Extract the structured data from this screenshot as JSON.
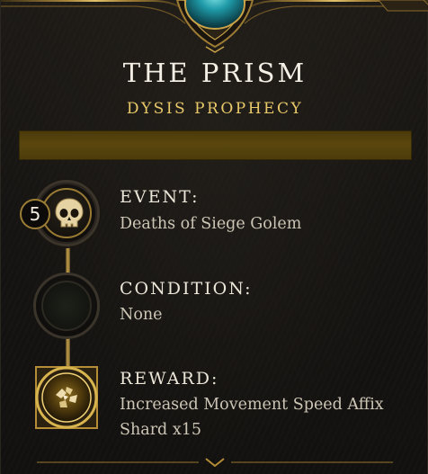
{
  "header": {
    "title": "THE PRISM",
    "subtitle": "DYSIS PROPHECY"
  },
  "progress": {
    "fraction": 0,
    "fill_color": "#5c470c",
    "track_color": "#4a3a0a"
  },
  "event": {
    "label": "EVENT:",
    "value": "Deaths of Siege Golem",
    "count_badge": "5",
    "icon": "skull-icon"
  },
  "condition": {
    "label": "CONDITION:",
    "value": "None",
    "icon": "empty-circle-icon"
  },
  "reward": {
    "label": "REWARD:",
    "value": "Increased Movement Speed Affix Shard x15",
    "icon": "affix-shard-icon"
  },
  "colors": {
    "gold": "#c9a347",
    "title": "#f4efe4",
    "subtitle": "#e9c96a",
    "text": "#cdc6b6",
    "gem": "#1f9aa8"
  }
}
